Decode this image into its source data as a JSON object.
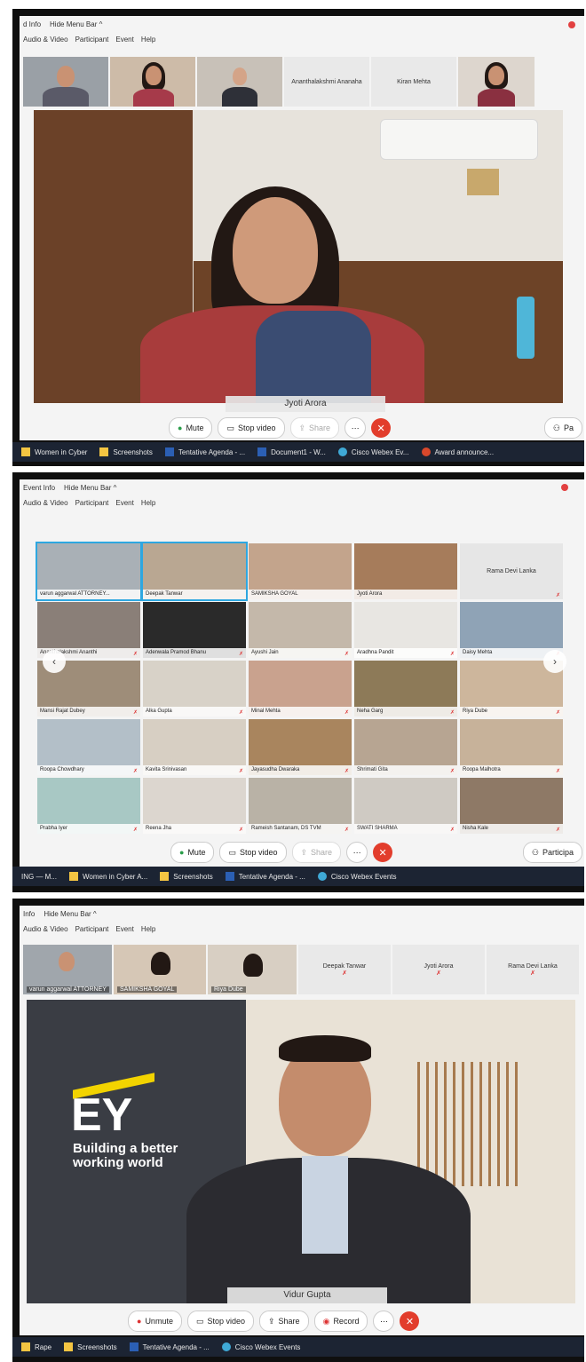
{
  "panel1": {
    "menubar": {
      "left": "d Info",
      "hide_menu": "Hide Menu Bar ^",
      "menus": [
        "Audio & Video",
        "Participant",
        "Event",
        "Help"
      ]
    },
    "thumbnails": [
      {
        "name": ""
      },
      {
        "name": ""
      },
      {
        "name": ""
      },
      {
        "name": "Ananthalakshmi Ananaha",
        "plain": true
      },
      {
        "name": "Kiran Mehta",
        "plain": true
      },
      {
        "name": ""
      }
    ],
    "speaker": "Jyoti Arora",
    "controls": {
      "mute": "Mute",
      "stop_video": "Stop video",
      "share": "Share",
      "more": "···"
    },
    "right_label": "Pa",
    "taskbar": [
      "Women in Cyber",
      "Screenshots",
      "Tentative Agenda - ...",
      "Document1 - W...",
      "Cisco Webex Ev...",
      "Award announce..."
    ]
  },
  "panel2": {
    "menubar": {
      "left": "Event Info",
      "hide_menu": "Hide Menu Bar ^",
      "menus": [
        "Audio & Video",
        "Participant",
        "Event",
        "Help"
      ]
    },
    "grid": [
      {
        "name": "varun aggarwal ATTORNEY...",
        "sel": true
      },
      {
        "name": "Deepak Tanwar",
        "sel": true
      },
      {
        "name": "SAMIKSHA GOYAL"
      },
      {
        "name": "Jyoti Arora"
      },
      {
        "name": "Rama Devi Lanka",
        "blank": true
      },
      {
        "name": "Ananthalakshmi Ananthi"
      },
      {
        "name": "Adenwala Pramod Bhanu"
      },
      {
        "name": "Ayushi Jain"
      },
      {
        "name": "Aradhna Pandit"
      },
      {
        "name": "Daisy Mehta"
      },
      {
        "name": "Mansi Rajat Dubey"
      },
      {
        "name": "Alka Gupta"
      },
      {
        "name": "Minal Mehta"
      },
      {
        "name": "Neha Garg"
      },
      {
        "name": "Riya Dube"
      },
      {
        "name": "Roopa Chowdhary"
      },
      {
        "name": "Kavita Srinivasan"
      },
      {
        "name": "Jayasudha Dwaraka"
      },
      {
        "name": "Shrimati Gita"
      },
      {
        "name": "Roopa Malhotra"
      },
      {
        "name": "Prabha Iyer"
      },
      {
        "name": "Reena Jha"
      },
      {
        "name": "Rameish Santanam, DS TVM"
      },
      {
        "name": "SWATI SHARMA"
      },
      {
        "name": "Nisha Kale"
      }
    ],
    "controls": {
      "mute": "Mute",
      "stop_video": "Stop video",
      "share": "Share",
      "more": "···"
    },
    "right_label": "Participa",
    "taskbar": [
      "ING — M...",
      "Women in Cyber A...",
      "Screenshots",
      "Tentative Agenda - ...",
      "Cisco Webex Events"
    ]
  },
  "panel3": {
    "menubar": {
      "left": "Info",
      "hide_menu": "Hide Menu Bar ^",
      "menus": [
        "Audio & Video",
        "Participant",
        "Event",
        "Help"
      ]
    },
    "thumbnails": [
      {
        "name": "varun aggarwal ATTORNEY"
      },
      {
        "name": "SAMIKSHA GOYAL"
      },
      {
        "name": "Riya Dube"
      },
      {
        "name": "Deepak Tanwar",
        "plain": true
      },
      {
        "name": "Jyoti Arora",
        "plain": true
      },
      {
        "name": "Rama Devi Lanka",
        "plain": true
      }
    ],
    "speaker": "Vidur Gupta",
    "ey": {
      "logo": "EY",
      "tagline_1": "Building a better",
      "tagline_2": "working world"
    },
    "controls": {
      "unmute": "Unmute",
      "stop_video": "Stop video",
      "share": "Share",
      "record": "Record",
      "more": "···"
    },
    "taskbar": [
      "Rape",
      "Screenshots",
      "Tentative Agenda - ...",
      "Cisco Webex Events"
    ]
  },
  "colors": {
    "accent": "#2ea7e0",
    "end_call": "#e23d2c",
    "taskbar": "#1c2433",
    "mic_muted": "#dd3333"
  },
  "icons": [
    "microphone-icon",
    "video-camera-icon",
    "share-icon",
    "record-icon",
    "end-call-icon",
    "participants-icon",
    "chevron-left-icon",
    "chevron-right-icon"
  ]
}
